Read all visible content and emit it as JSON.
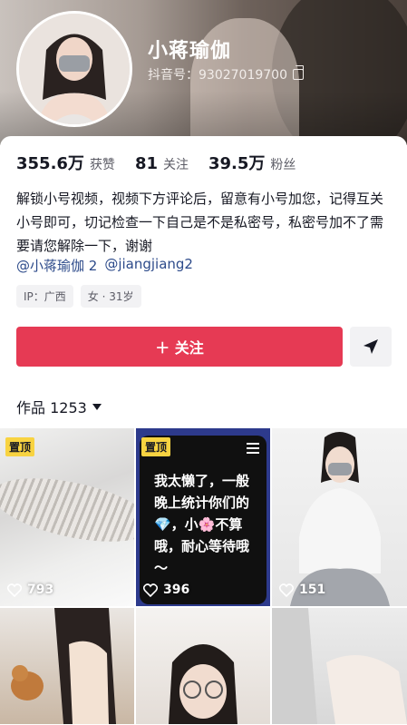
{
  "profile": {
    "name": "小蒋瑜伽",
    "douyin_id": "抖音号：93027019700"
  },
  "stats": [
    {
      "value": "355.6万",
      "label": "获赞"
    },
    {
      "value": "81",
      "label": "关注"
    },
    {
      "value": "39.5万",
      "label": "粉丝"
    }
  ],
  "bio": "解锁小号视频，视频下方评论后，留意有小号加您，记得互关小号即可，切记检查一下自己是不是私密号，私密号加不了需要请您解除一下，谢谢",
  "mentions": [
    "@小蒋瑜伽 2",
    "@jiangjiang2"
  ],
  "tags": [
    "IP：广西",
    "女 · 31岁"
  ],
  "actions": {
    "follow_label": "＋ 关注",
    "share_icon": "send-icon"
  },
  "works": {
    "label": "作品 1253"
  },
  "grid": [
    {
      "pinned": "置顶",
      "likes": "793"
    },
    {
      "pinned": "置顶",
      "likes": "396",
      "overlay_text": "我太懒了，一般晚上统计你们的💎，小🌸不算哦，耐心等待哦～"
    },
    {
      "pinned": "",
      "likes": "151"
    },
    {
      "pinned": "",
      "likes": ""
    },
    {
      "pinned": "",
      "likes": ""
    },
    {
      "pinned": "",
      "likes": ""
    }
  ],
  "colors": {
    "accent": "#e63a54",
    "pin_badge": "#f8d341",
    "mention": "#2c4a8a"
  }
}
